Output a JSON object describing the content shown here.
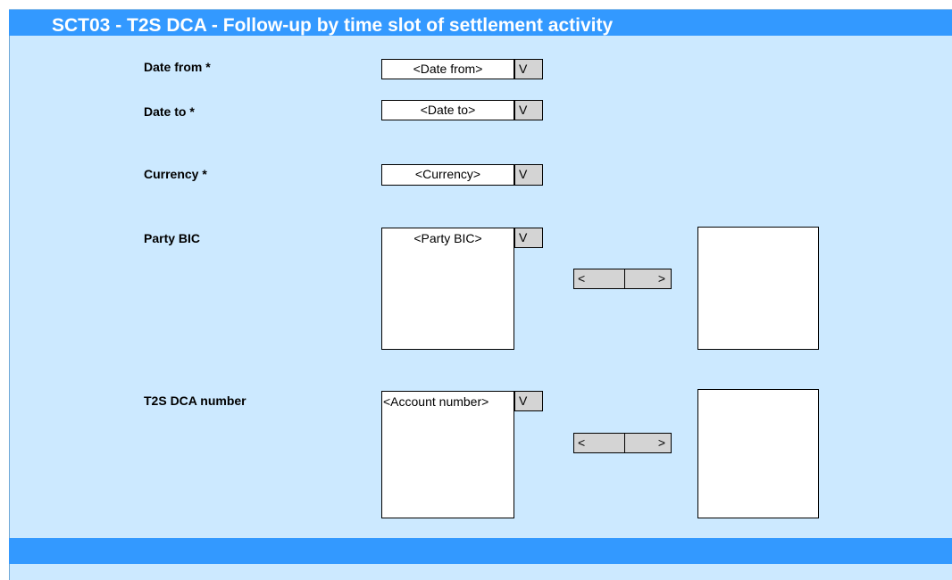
{
  "title": "SCT03 - T2S DCA - Follow-up by time slot of settlement activity",
  "fields": {
    "date_from": {
      "label": "Date from *",
      "placeholder": "<Date from>",
      "dropdown": "V"
    },
    "date_to": {
      "label": "Date to *",
      "placeholder": "<Date to>",
      "dropdown": "V"
    },
    "currency": {
      "label": "Currency *",
      "placeholder": "<Currency>",
      "dropdown": "V"
    },
    "party_bic": {
      "label": "Party BIC",
      "placeholder": "<Party BIC>",
      "dropdown": "V",
      "move_left": "<",
      "move_right": ">"
    },
    "dca_number": {
      "label": "T2S DCA number",
      "placeholder": "<Account number>",
      "dropdown": "V",
      "move_left": "<",
      "move_right": ">"
    }
  },
  "colors": {
    "header_blue": "#3399ff",
    "panel_bg": "#cce9ff",
    "button_gray": "#d4d4d4"
  }
}
